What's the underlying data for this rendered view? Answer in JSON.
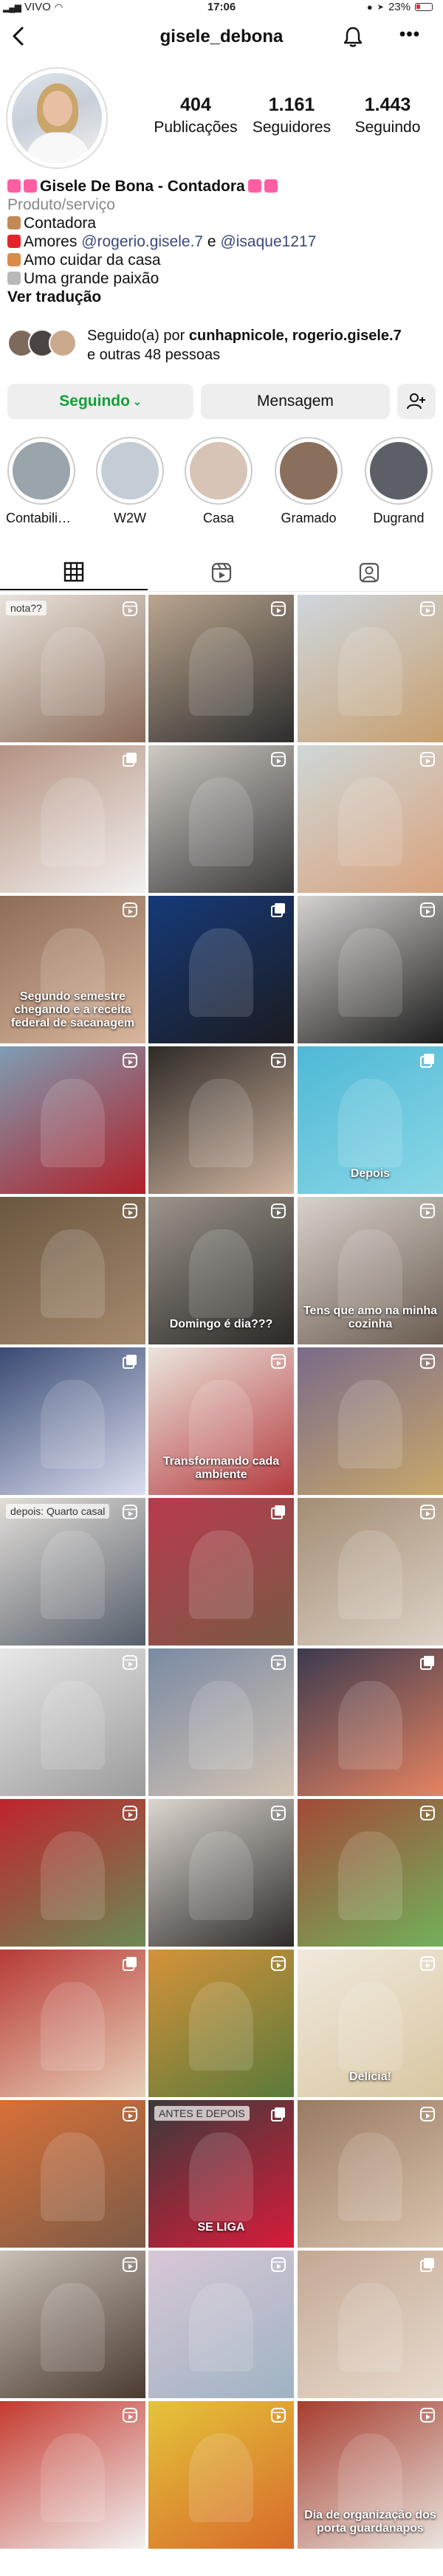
{
  "status": {
    "carrier": "VIVO",
    "time": "17:06",
    "battery": "23%"
  },
  "header": {
    "username": "gisele_debona"
  },
  "stats": [
    {
      "num": "404",
      "label": "Publicações"
    },
    {
      "num": "1.161",
      "label": "Seguidores"
    },
    {
      "num": "1.443",
      "label": "Seguindo"
    }
  ],
  "bio": {
    "name": "Gisele De Bona - Contadora",
    "category": "Produto/serviço",
    "line1": "Contadora",
    "line2_prefix": "Amores ",
    "link1": "@rogerio.gisele.7",
    "line2_mid": " e ",
    "link2": "@isaque1217",
    "line3": "Amo cuidar da casa",
    "line4": "Uma grande paixão",
    "translate": "Ver tradução"
  },
  "followed_by": {
    "prefix": "Seguido(a) por ",
    "users": "cunhapnicole, rogerio.gisele.7",
    "suffix": " e outras 48 pessoas"
  },
  "buttons": {
    "follow": "Seguindo",
    "message": "Mensagem"
  },
  "highlights": [
    {
      "label": "Contabilidade",
      "color": "#9aa4ab"
    },
    {
      "label": "W2W",
      "color": "#c4cdd6"
    },
    {
      "label": "Casa",
      "color": "#d7c4b7"
    },
    {
      "label": "Gramado",
      "color": "#8b6f5d"
    },
    {
      "label": "Dugrand",
      "color": "#5c5f66"
    }
  ],
  "grid": [
    {
      "c1": "#e9e3dc",
      "c2": "#8a6b58",
      "caption": "",
      "label": "nota??"
    },
    {
      "c1": "#bba68f",
      "c2": "#2d2d2d",
      "caption": "",
      "label": ""
    },
    {
      "c1": "#cfd7de",
      "c2": "#c79f6f",
      "caption": "",
      "label": ""
    },
    {
      "c1": "#b59282",
      "c2": "#f3f1ef",
      "caption": "",
      "label": ""
    },
    {
      "c1": "#cfc9c2",
      "c2": "#3a3a3a",
      "caption": "",
      "label": ""
    },
    {
      "c1": "#cfd7d6",
      "c2": "#d9a37e",
      "caption": "",
      "label": ""
    },
    {
      "c1": "#8f6c57",
      "c2": "#d8b59c",
      "caption": "Segundo semestre chegando e a receita federal de sacanagem",
      "label": ""
    },
    {
      "c1": "#163a7a",
      "c2": "#1b1b1f",
      "caption": "",
      "label": ""
    },
    {
      "c1": "#d5d2cf",
      "c2": "#1f1f1f",
      "caption": "",
      "label": ""
    },
    {
      "c1": "#7e9db3",
      "c2": "#b11f28",
      "caption": "",
      "label": ""
    },
    {
      "c1": "#2e2a27",
      "c2": "#d2b6a1",
      "caption": "",
      "label": ""
    },
    {
      "c1": "#4fb8d6",
      "c2": "#8ad7e6",
      "caption": "Depois",
      "label": ""
    },
    {
      "c1": "#6b5640",
      "c2": "#a58a6e",
      "caption": "",
      "label": ""
    },
    {
      "c1": "#9c958c",
      "c2": "#2b2825",
      "caption": "Domingo é dia???",
      "label": ""
    },
    {
      "c1": "#d8d2cb",
      "c2": "#6a5c51",
      "caption": "Tens que amo na minha cozinha",
      "label": ""
    },
    {
      "c1": "#3a4a74",
      "c2": "#dcdff0",
      "caption": "",
      "label": ""
    },
    {
      "c1": "#ebe5dd",
      "c2": "#b53b3f",
      "caption": "Transformando cada ambiente",
      "label": ""
    },
    {
      "c1": "#7a6a89",
      "c2": "#c8a86b",
      "caption": "",
      "label": ""
    },
    {
      "c1": "#e2ddd8",
      "c2": "#565f6b",
      "caption": "",
      "label": "depois: Quarto casal"
    },
    {
      "c1": "#b93a4d",
      "c2": "#7a5a45",
      "caption": "",
      "label": ""
    },
    {
      "c1": "#a48d74",
      "c2": "#dcd2c6",
      "caption": "",
      "label": ""
    },
    {
      "c1": "#e8e8e8",
      "c2": "#9b9b9b",
      "caption": "",
      "label": ""
    },
    {
      "c1": "#7a8aa3",
      "c2": "#d3c3b3",
      "caption": "",
      "label": ""
    },
    {
      "c1": "#3d3a4f",
      "c2": "#e58361",
      "caption": "",
      "label": ""
    },
    {
      "c1": "#c1232e",
      "c2": "#6a8a54",
      "caption": "",
      "label": ""
    },
    {
      "c1": "#dcd6cf",
      "c2": "#2d2a29",
      "caption": "",
      "label": ""
    },
    {
      "c1": "#a34a38",
      "c2": "#71b05a",
      "caption": "",
      "label": ""
    },
    {
      "c1": "#b83a36",
      "c2": "#e7d0b8",
      "caption": "",
      "label": ""
    },
    {
      "c1": "#d6923a",
      "c2": "#5a7a3a",
      "caption": "",
      "label": ""
    },
    {
      "c1": "#f0e9dc",
      "c2": "#d9c7a3",
      "caption": "Delícia!",
      "label": ""
    },
    {
      "c1": "#d77038",
      "c2": "#7c5b47",
      "caption": "",
      "label": ""
    },
    {
      "c1": "#3b3b3b",
      "c2": "#d81b3a",
      "caption": "SE LIGA",
      "label": "ANTES E DEPOIS"
    },
    {
      "c1": "#9a7a62",
      "c2": "#d9c4ae",
      "caption": "",
      "label": ""
    },
    {
      "c1": "#c9c0b6",
      "c2": "#4a3a32",
      "caption": "",
      "label": ""
    },
    {
      "c1": "#d8c7d6",
      "c2": "#9fb3c3",
      "caption": "",
      "label": ""
    },
    {
      "c1": "#c4a894",
      "c2": "#e8dbcd",
      "caption": "",
      "label": ""
    },
    {
      "c1": "#c43a2e",
      "c2": "#f2f2f2",
      "caption": "",
      "label": ""
    },
    {
      "c1": "#e5c43a",
      "c2": "#d66a2a",
      "caption": "",
      "label": ""
    },
    {
      "c1": "#a63d2e",
      "c2": "#e9e4de",
      "caption": "Dia de organização dos porta guardanapos",
      "label": ""
    }
  ]
}
